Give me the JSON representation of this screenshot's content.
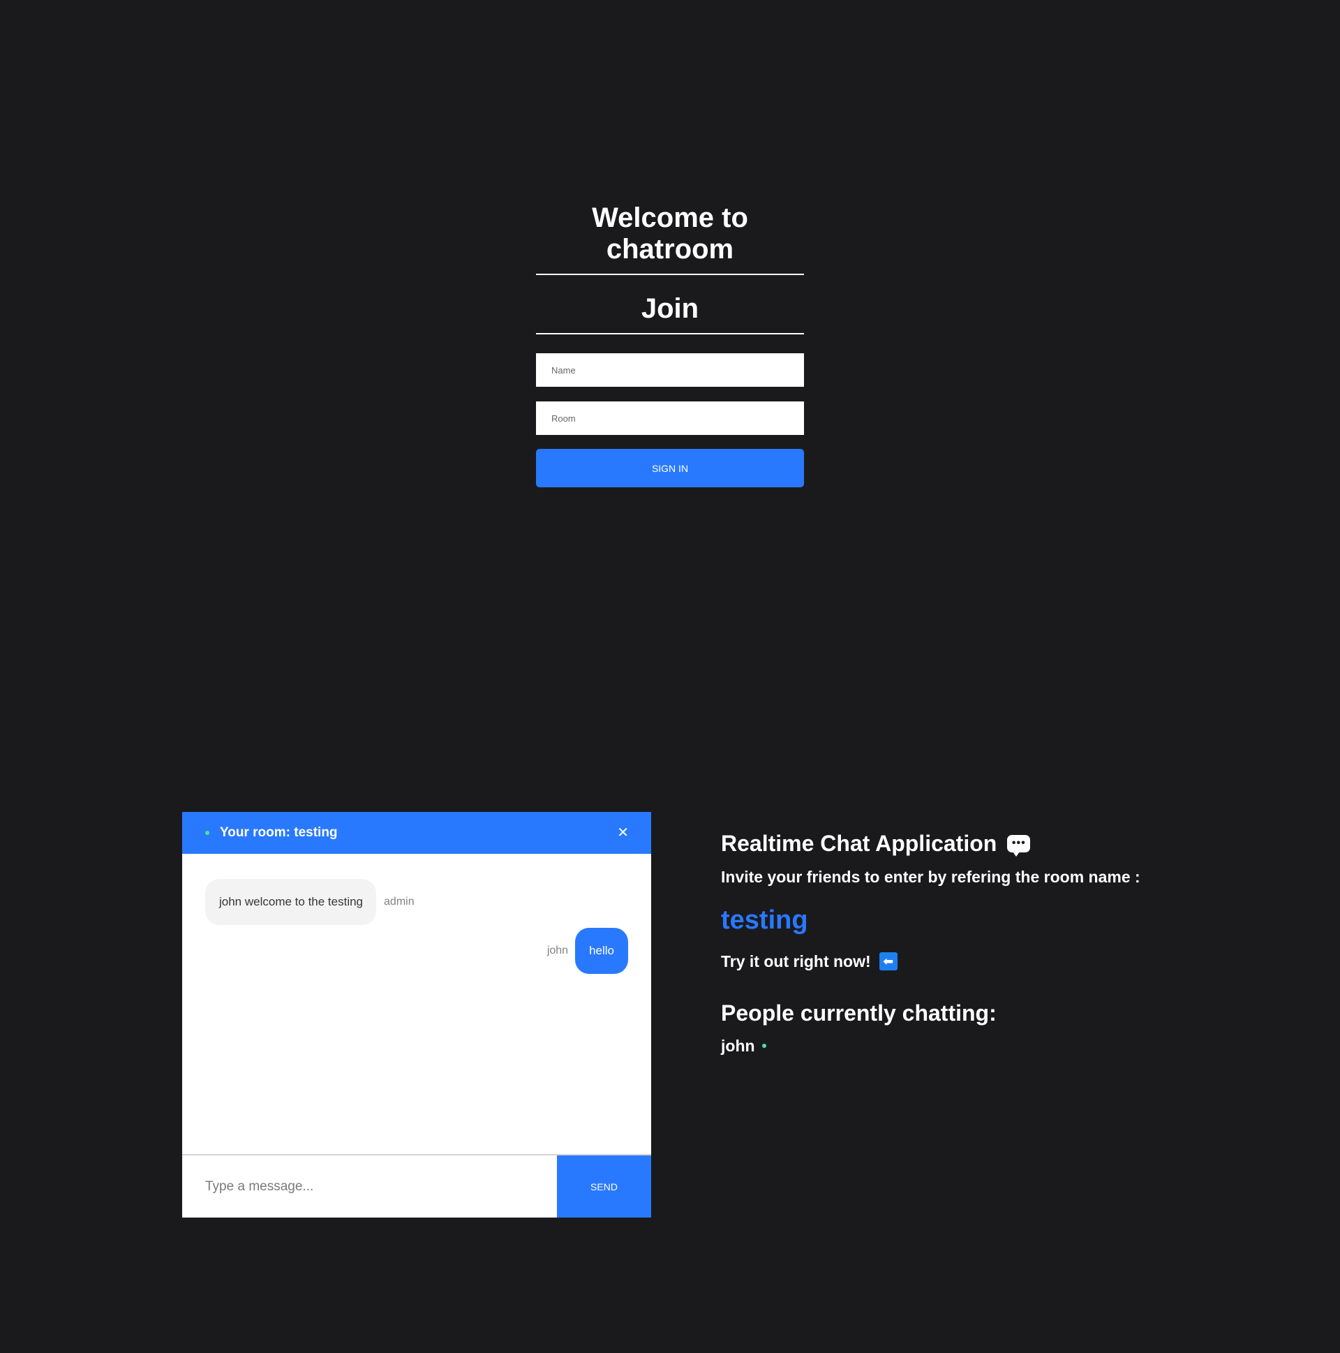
{
  "join": {
    "title": "Welcome to chatroom",
    "heading": "Join",
    "name_placeholder": "Name",
    "name_value": "",
    "room_placeholder": "Room",
    "room_value": "",
    "signin_label": "Sign In"
  },
  "chat": {
    "header_title": "Your room: testing",
    "close_icon": "close-icon",
    "close_glyph": "✕",
    "online_color": "#4ce0a0",
    "messages": [
      {
        "text": "john welcome to the testing",
        "sender": "admin",
        "own": false
      },
      {
        "text": "hello",
        "sender": "john",
        "own": true
      }
    ],
    "input_placeholder": "Type a message...",
    "input_value": "",
    "send_label": "Send"
  },
  "info": {
    "title": "Realtime Chat Application",
    "title_icon": "chat-bubble-icon",
    "title_icon_glyph": "•••",
    "invite_text": "Invite your friends to enter by refering the room name :",
    "room_name": "testing",
    "try_text": "Try it out right now!",
    "try_icon": "arrow-left-icon",
    "try_icon_glyph": "⬅",
    "people_heading": "People currently chatting:",
    "people": [
      "john"
    ]
  },
  "colors": {
    "background": "#1a1a1d",
    "accent": "#2979ff",
    "online": "#4ce0a0"
  }
}
